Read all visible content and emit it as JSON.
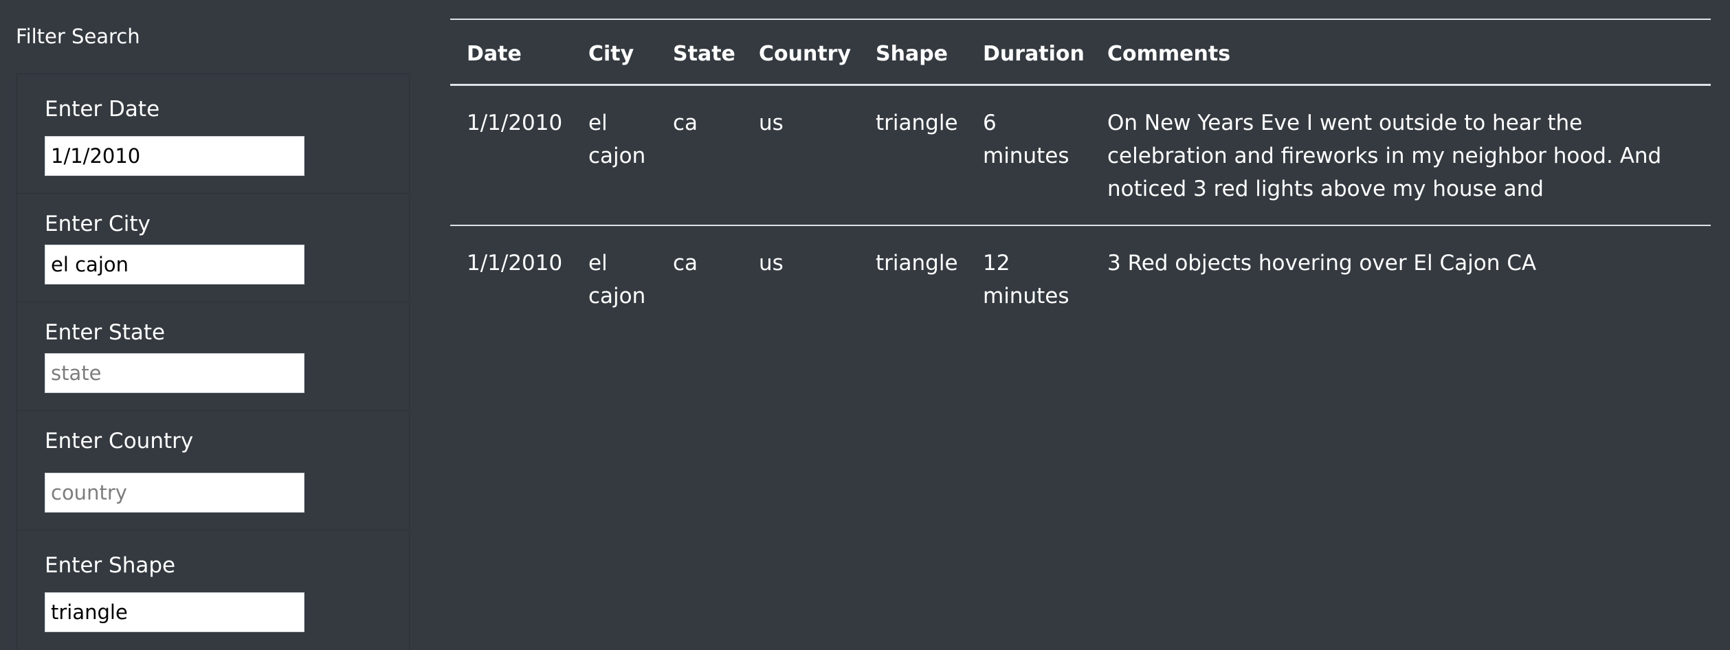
{
  "filter": {
    "title": "Filter Search",
    "fields": [
      {
        "label": "Enter Date",
        "value": "1/1/2010",
        "placeholder": ""
      },
      {
        "label": "Enter City",
        "value": "el cajon",
        "placeholder": ""
      },
      {
        "label": "Enter State",
        "value": "",
        "placeholder": "state"
      },
      {
        "label": "Enter Country",
        "value": "",
        "placeholder": "country"
      },
      {
        "label": "Enter Shape",
        "value": "triangle",
        "placeholder": ""
      }
    ]
  },
  "table": {
    "headers": {
      "date": "Date",
      "city": "City",
      "state": "State",
      "country": "Country",
      "shape": "Shape",
      "duration": "Duration",
      "comments": "Comments"
    },
    "rows": [
      {
        "date": "1/1/2010",
        "city": "el cajon",
        "state": "ca",
        "country": "us",
        "shape": "triangle",
        "duration": "6 minutes",
        "comments": "On New Years Eve I went outside to hear the celebration and fireworks in my neighbor hood. And noticed 3 red lights above my house and"
      },
      {
        "date": "1/1/2010",
        "city": "el cajon",
        "state": "ca",
        "country": "us",
        "shape": "triangle",
        "duration": "12 minutes",
        "comments": "3 Red objects hovering over El Cajon CA"
      }
    ]
  }
}
